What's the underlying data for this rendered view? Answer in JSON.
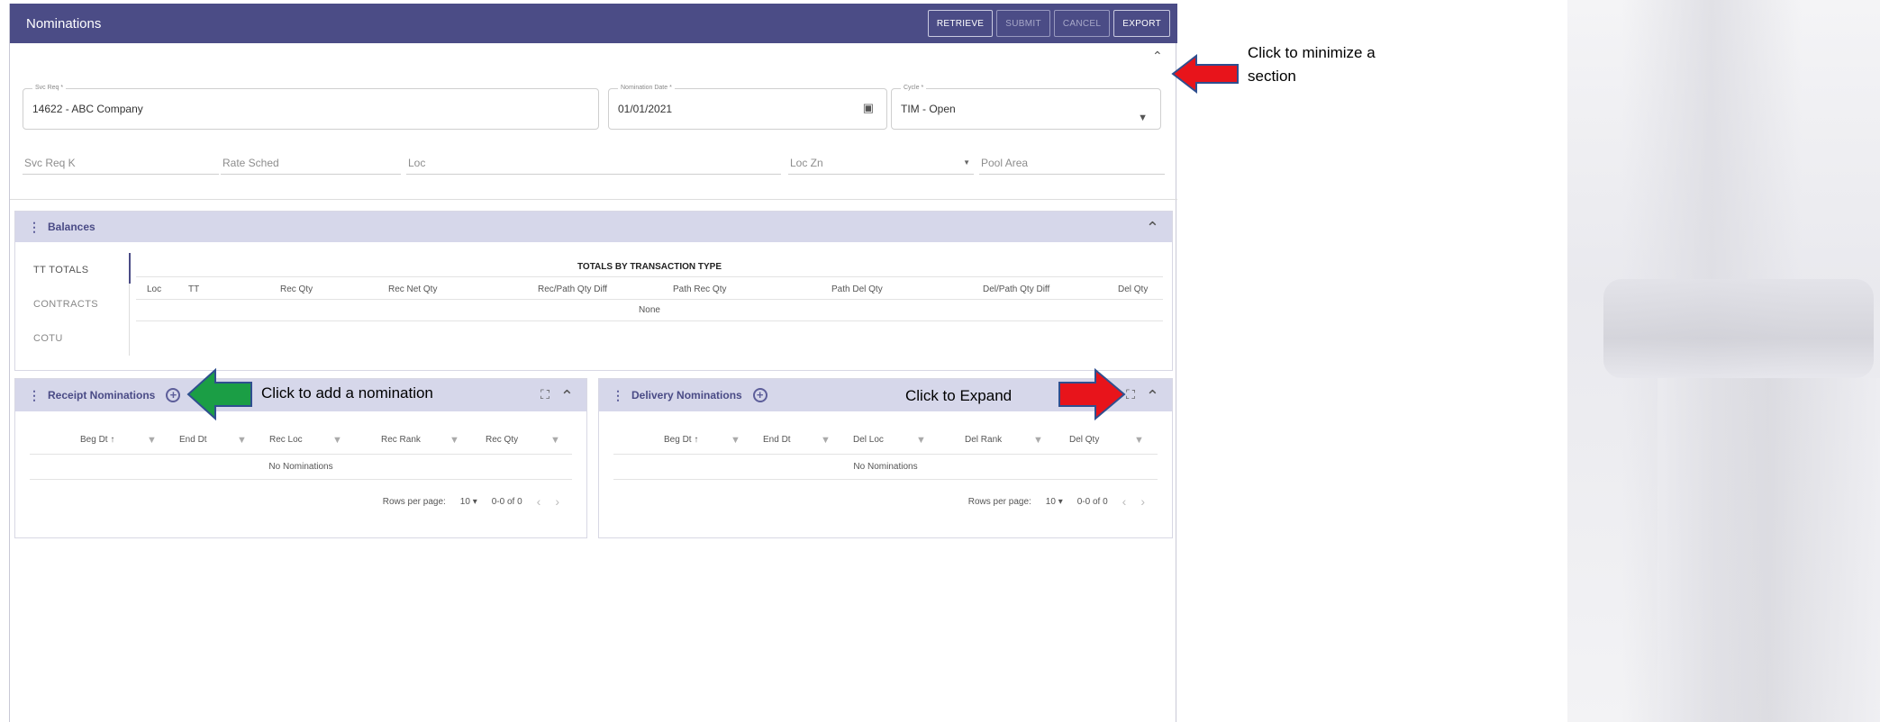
{
  "app": {
    "title": "Nominations"
  },
  "toolbar": {
    "retrieve": "RETRIEVE",
    "submit": "SUBMIT",
    "cancel": "CANCEL",
    "export": "EXPORT"
  },
  "filters": {
    "svc_req": {
      "label": "Svc Req *",
      "value": "14622 - ABC Company"
    },
    "nomination_date": {
      "label": "Nomination Date *",
      "value": "01/01/2021"
    },
    "cycle": {
      "label": "Cycle *",
      "value": "TIM - Open"
    },
    "svc_req_k": "Svc Req K",
    "rate_sched": "Rate Sched",
    "loc": "Loc",
    "loc_zn": "Loc Zn",
    "pool_area": "Pool Area"
  },
  "balances": {
    "title": "Balances",
    "tabs": [
      "TT TOTALS",
      "CONTRACTS",
      "COTU"
    ],
    "caption": "TOTALS BY TRANSACTION TYPE",
    "columns": [
      "Loc",
      "TT",
      "Rec Qty",
      "Rec Net Qty",
      "Rec/Path Qty Diff",
      "Path Rec Qty",
      "Path Del Qty",
      "Del/Path Qty Diff",
      "Del Qty"
    ],
    "empty": "None"
  },
  "receipt": {
    "title": "Receipt Nominations",
    "columns": [
      "Beg Dt ↑",
      "End Dt",
      "Rec Loc",
      "Rec Rank",
      "Rec Qty"
    ],
    "empty": "No Nominations",
    "rows_per_page_label": "Rows per page:",
    "rows_per_page": "10",
    "range": "0-0 of 0"
  },
  "delivery": {
    "title": "Delivery Nominations",
    "columns": [
      "Beg Dt ↑",
      "End Dt",
      "Del Loc",
      "Del Rank",
      "Del Qty"
    ],
    "empty": "No Nominations",
    "rows_per_page_label": "Rows per page:",
    "rows_per_page": "10",
    "range": "0-0 of 0"
  },
  "annotations": {
    "minimize": "Click to minimize a section",
    "add": "Click to add a nomination",
    "expand": "Click to Expand"
  },
  "colors": {
    "header": "#4b4c86",
    "panel_header": "#d6d7ea",
    "arrow_red": "#e8141b",
    "arrow_green": "#1b9e45",
    "arrow_border": "#2f4f8f"
  }
}
